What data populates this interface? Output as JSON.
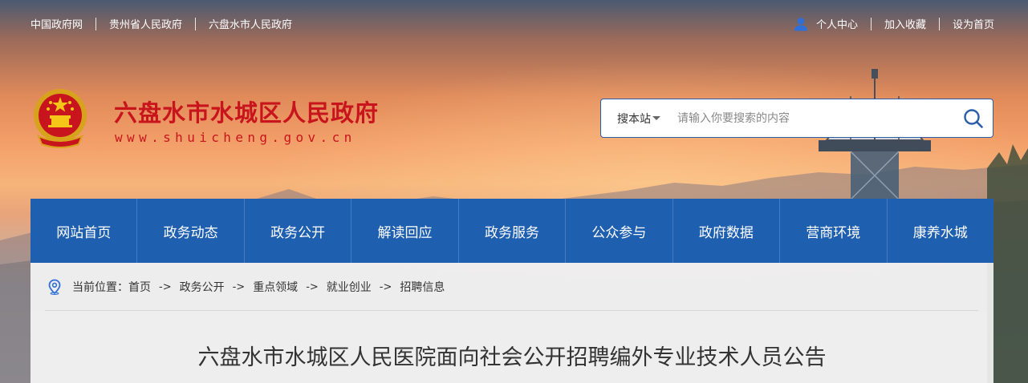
{
  "topbar": {
    "links": [
      "中国政府网",
      "贵州省人民政府",
      "六盘水市人民政府"
    ],
    "right_links": [
      "个人中心",
      "加入收藏",
      "设为首页"
    ],
    "user_icon": "user-icon"
  },
  "header": {
    "title": "六盘水市水城区人民政府",
    "url": "www.shuicheng.gov.cn",
    "emblem_icon": "national-emblem-icon"
  },
  "search": {
    "scope_label": "搜本站",
    "placeholder": "请输入你要搜索的内容",
    "value": "",
    "button_icon": "search-icon"
  },
  "nav": {
    "items": [
      "网站首页",
      "政务动态",
      "政务公开",
      "解读回应",
      "政务服务",
      "公众参与",
      "政府数据",
      "营商环境",
      "康养水城"
    ]
  },
  "breadcrumb": {
    "prefix": "当前位置：",
    "items": [
      "首页",
      "政务公开",
      "重点领域",
      "就业创业",
      "招聘信息"
    ],
    "separator": "->"
  },
  "article": {
    "title": "六盘水市水城区人民医院面向社会公开招聘编外专业技术人员公告"
  },
  "colors": {
    "brand_red": "#c8151d",
    "nav_blue": "#1f5fb0",
    "search_border": "#2a5ea8"
  }
}
